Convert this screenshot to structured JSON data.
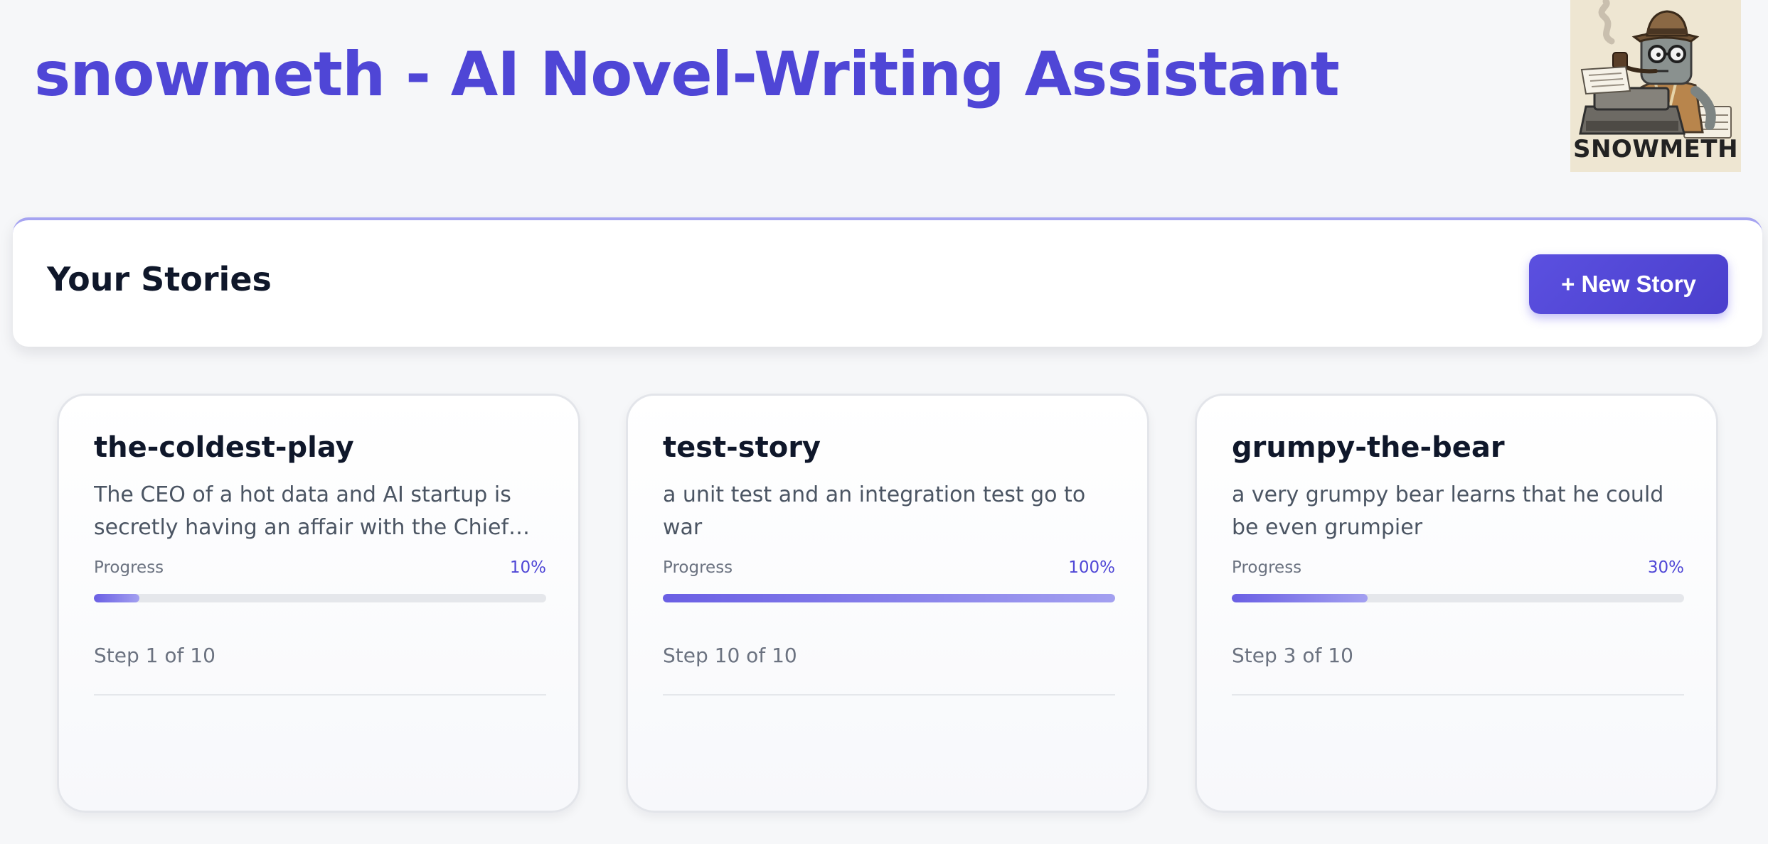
{
  "app": {
    "title": "snowmeth - AI Novel-Writing Assistant",
    "logo_text": "SNOWMETH",
    "accent_color": "#4f46d6"
  },
  "stories_header": {
    "title": "Your Stories",
    "new_story_label": "+ New Story"
  },
  "stories": [
    {
      "title": "the-coldest-play",
      "description": "The CEO of a hot data and AI startup is secretly having an affair with the Chief People Officer",
      "progress_label": "Progress",
      "progress_text": "10%",
      "progress_fraction": 0.1,
      "step_text": "Step 1 of 10"
    },
    {
      "title": "test-story",
      "description": "a unit test and an integration test go to war",
      "progress_label": "Progress",
      "progress_text": "100%",
      "progress_fraction": 1.0,
      "step_text": "Step 10 of 10"
    },
    {
      "title": "grumpy-the-bear",
      "description": "a very grumpy bear learns that he could be even grumpier",
      "progress_label": "Progress",
      "progress_text": "30%",
      "progress_fraction": 0.3,
      "step_text": "Step 3 of 10"
    }
  ]
}
